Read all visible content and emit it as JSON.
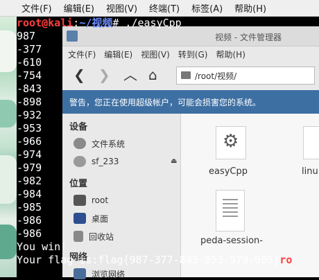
{
  "menubar": {
    "items": [
      "文件(F)",
      "编辑(E)",
      "视图(V)",
      "终端(T)",
      "标签(A)",
      "帮助(H)"
    ]
  },
  "terminal": {
    "prompt_user": "root@kali",
    "prompt_sep": ":",
    "prompt_path": "~/视频",
    "prompt_symbol": "#",
    "command": " ./easyCpp",
    "output_lines": [
      "987",
      "-377",
      "-610",
      "-754",
      "-843",
      "-898",
      "-932",
      "-953",
      "-966",
      "-974",
      "-979",
      "-982",
      "-984",
      "-985",
      "-986",
      "-986",
      "You win!"
    ],
    "flag_line": "Your flag is:flag{987-377-843-953-979-985}",
    "trailing_prompt": "ro"
  },
  "file_manager": {
    "title": "视频 - 文件管理器",
    "menu": [
      "文件(F)",
      "编辑(E)",
      "视图(V)",
      "转到(G)",
      "帮助(H)"
    ],
    "path": "/root/视频/",
    "warning": "警告，您正在使用超级帐户，可能会损害您的系统。",
    "sidebar": {
      "devices_header": "设备",
      "devices": [
        "文件系统",
        "sf_233"
      ],
      "places_header": "位置",
      "places": [
        "root",
        "桌面",
        "回收站"
      ],
      "network_header": "网络",
      "network": [
        "浏览网络"
      ]
    },
    "files": [
      {
        "name": "easyCpp",
        "icon": "gear-file-icon"
      },
      {
        "name": "linu",
        "icon": "text-file-icon"
      },
      {
        "name": "peda-session-",
        "icon": "text-file-icon"
      }
    ]
  }
}
